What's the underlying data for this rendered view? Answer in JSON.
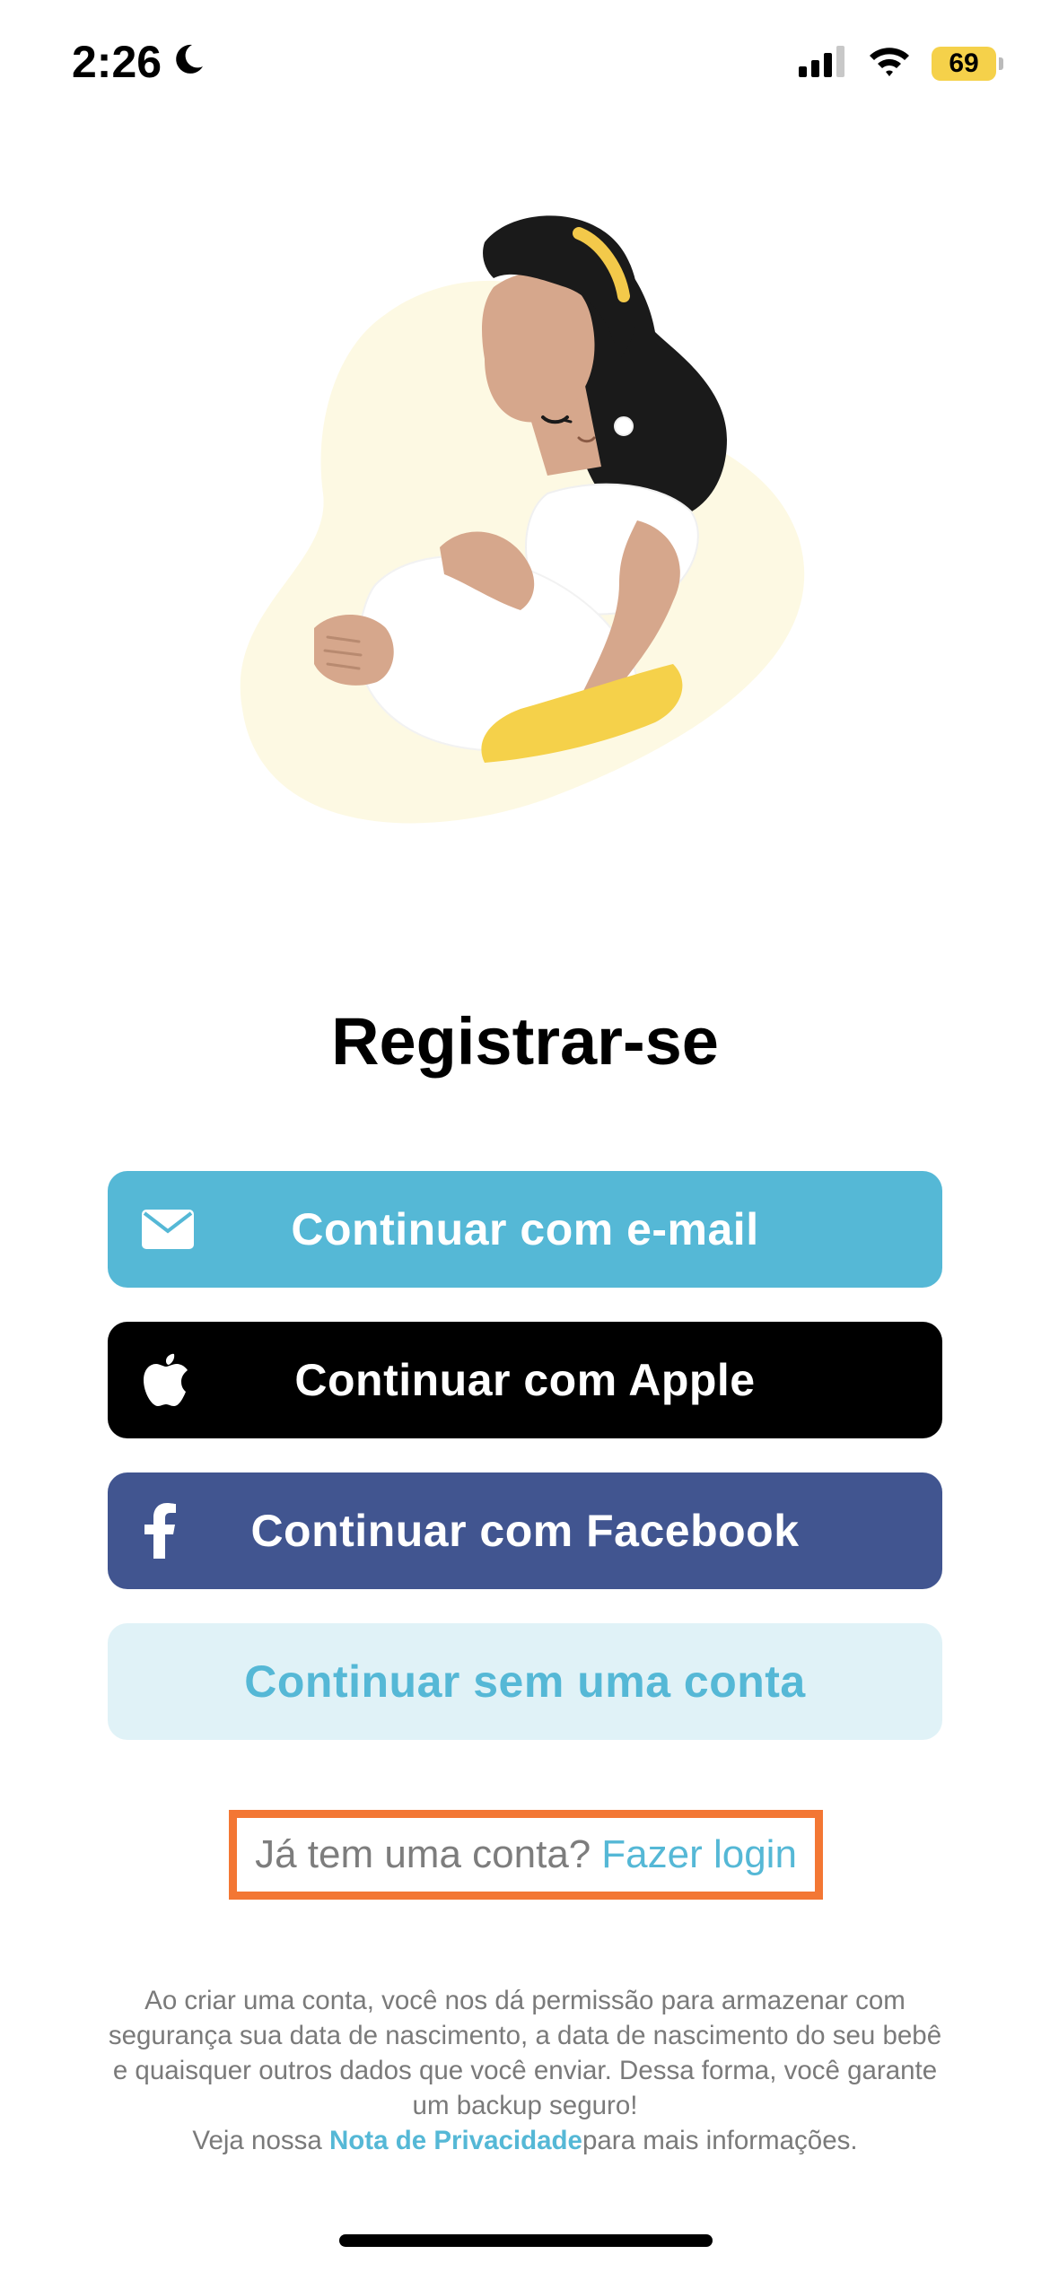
{
  "status_bar": {
    "time": "2:26",
    "battery": "69"
  },
  "signup": {
    "title": "Registrar-se",
    "email_button": "Continuar com e-mail",
    "apple_button": "Continuar com Apple",
    "facebook_button": "Continuar com Facebook",
    "guest_button": "Continuar sem uma conta",
    "login_prompt": "Já tem uma conta?",
    "login_link": "Fazer login",
    "disclaimer_text": "Ao criar uma conta, você nos dá permissão para armazenar com segurança sua data de nascimento, a data de nascimento do seu bebê e quaisquer outros dados que você enviar. Dessa forma, você garante um backup seguro!",
    "privacy_prefix": "Veja nossa ",
    "privacy_link": "Nota de Privacidade",
    "privacy_suffix": "para mais informações."
  },
  "icons": {
    "status": [
      "moon-icon",
      "cellular-signal-icon",
      "wifi-icon",
      "battery-icon"
    ],
    "buttons": [
      "mail-icon",
      "apple-logo-icon",
      "facebook-logo-icon"
    ]
  },
  "colors": {
    "email_button": "#55b8d6",
    "apple_button": "#000000",
    "facebook_button": "#415590",
    "guest_button_bg": "#e0f2f7",
    "link": "#55b8d6",
    "highlight_border": "#f37734",
    "battery": "#f5d14a"
  }
}
